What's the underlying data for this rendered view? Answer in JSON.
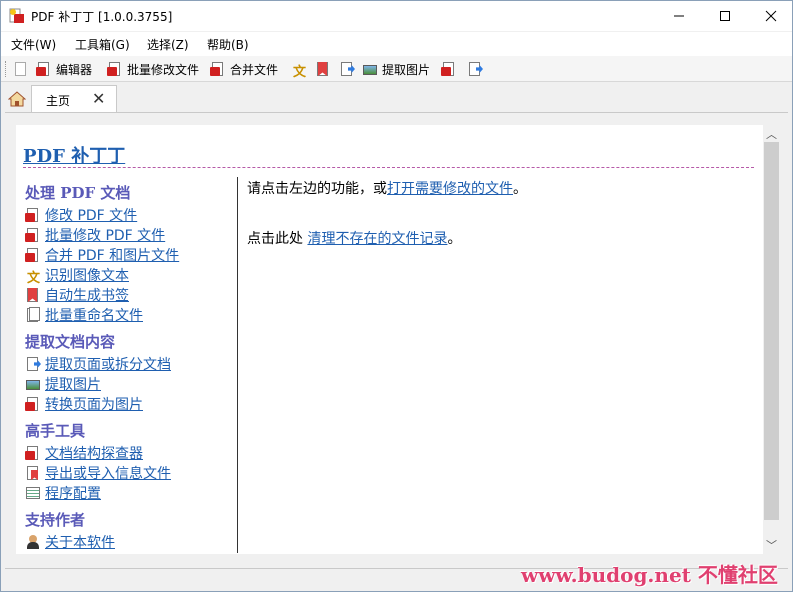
{
  "window": {
    "title": "PDF 补丁丁 [1.0.0.3755]"
  },
  "menu": [
    "文件(W)",
    "工具箱(G)",
    "选择(Z)",
    "帮助(B)"
  ],
  "toolbar": {
    "editor": "编辑器",
    "batch_modify": "批量修改文件",
    "merge": "合并文件",
    "extract_images": "提取图片"
  },
  "tabs": {
    "main": "主页"
  },
  "content": {
    "title": "PDF 补丁丁",
    "sections": [
      {
        "heading": "处理 PDF 文档",
        "items": [
          "修改 PDF 文件",
          "批量修改 PDF 文件",
          "合并 PDF 和图片文件",
          "识别图像文本",
          "自动生成书签",
          "批量重命名文件"
        ]
      },
      {
        "heading": "提取文档内容",
        "items": [
          "提取页面或拆分文档",
          "提取图片",
          "转换页面为图片"
        ]
      },
      {
        "heading": "高手工具",
        "items": [
          "文档结构探查器",
          "导出或导入信息文件",
          "程序配置"
        ]
      },
      {
        "heading": "支持作者",
        "items": [
          "关于本软件"
        ]
      }
    ],
    "message1_prefix": "请点击左边的功能，或",
    "message1_link": "打开需要修改的文件",
    "message1_suffix": "。",
    "message2_prefix": "点击此处 ",
    "message2_link": "清理不存在的文件记录",
    "message2_suffix": "。"
  },
  "watermark": "www.budog.net 不懂社区"
}
